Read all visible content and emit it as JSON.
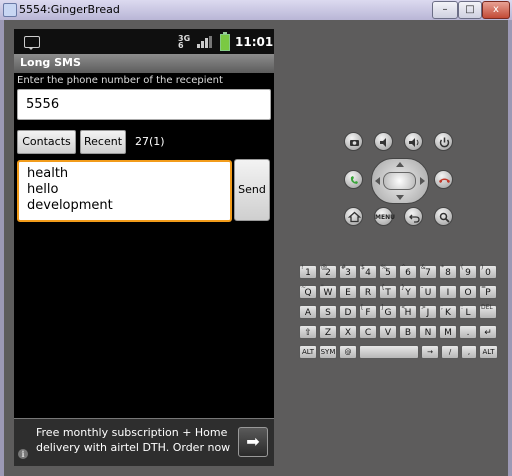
{
  "window": {
    "title": "5554:GingerBread",
    "buttons": [
      "–",
      "□",
      "x"
    ]
  },
  "status_bar": {
    "network": [
      "3G",
      "6"
    ],
    "time": "11:01"
  },
  "app": {
    "title": "Long SMS",
    "instruction": "Enter the phone number of the recepient",
    "phone_number": "5556",
    "contacts_label": "Contacts",
    "recent_label": "Recent",
    "char_count": "27(1)",
    "message_lines": [
      "health",
      "hello",
      "development"
    ],
    "send_label": "Send"
  },
  "ad": {
    "text": "Free monthly subscription + Home delivery with airtel DTH. Order now",
    "arrow": "➡",
    "info": "i"
  },
  "controls": {
    "camera": "camera-icon",
    "vol_down": "volume-down-icon",
    "vol_up": "volume-up-icon",
    "power": "power-icon",
    "call": "call-icon",
    "end_call": "end-call-icon",
    "home": "home-icon",
    "menu": "MENU",
    "back": "back-icon",
    "search": "search-icon"
  },
  "keyboard": {
    "rows": [
      [
        [
          "!",
          "1"
        ],
        [
          "@",
          "2"
        ],
        [
          "#",
          "3"
        ],
        [
          "$",
          "4"
        ],
        [
          "%",
          "5"
        ],
        [
          "^",
          "6"
        ],
        [
          "&",
          "7"
        ],
        [
          "*",
          "8"
        ],
        [
          "(",
          "9"
        ],
        [
          ")",
          "0"
        ]
      ],
      [
        [
          "~",
          "Q"
        ],
        [
          "\"",
          "W"
        ],
        [
          "",
          "E"
        ],
        [
          "",
          "R"
        ],
        [
          "{",
          "T"
        ],
        [
          "}",
          "Y"
        ],
        [
          "-",
          "U"
        ],
        [
          "",
          "I"
        ],
        [
          "",
          "O"
        ],
        [
          "=",
          "P"
        ]
      ],
      [
        [
          "",
          "A"
        ],
        [
          "",
          "S"
        ],
        [
          "",
          "D"
        ],
        [
          "[",
          "F"
        ],
        [
          "]",
          "G"
        ],
        [
          "<",
          "H"
        ],
        [
          ">",
          "J"
        ],
        [
          ";",
          "K"
        ],
        [
          ":",
          "L"
        ],
        [
          "DEL",
          ""
        ]
      ],
      [
        [
          "",
          "⇧"
        ],
        [
          "",
          "Z"
        ],
        [
          "",
          "X"
        ],
        [
          "",
          "C"
        ],
        [
          "",
          "V"
        ],
        [
          "",
          "B"
        ],
        [
          "",
          "N"
        ],
        [
          "",
          "M"
        ],
        [
          "",
          "."
        ],
        [
          "",
          "↵"
        ]
      ]
    ],
    "bottom_row": [
      "ALT",
      "SYM",
      "@",
      "",
      "→",
      "/",
      ",",
      "ALT"
    ]
  },
  "colors": {
    "accent_focus": "#f29c1b",
    "battery": "#7ac943",
    "call": "#3aa53a",
    "end_call": "#c0392b"
  }
}
